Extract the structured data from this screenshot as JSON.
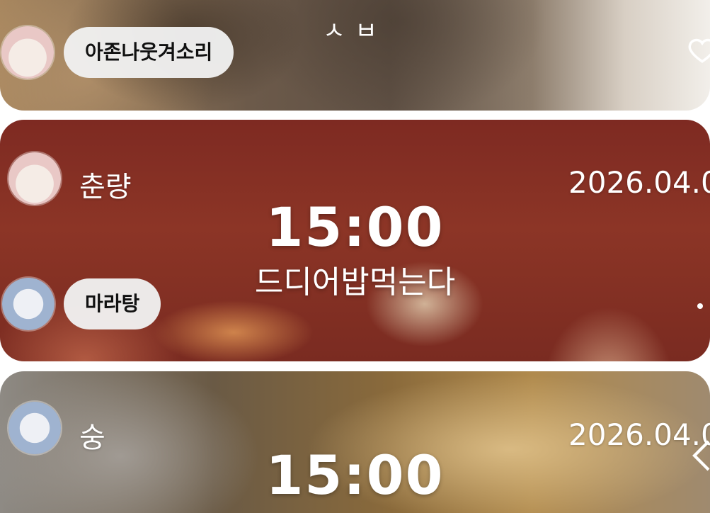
{
  "feed": {
    "top_title": "ㅅㅂ",
    "posts": [
      {
        "reply_user": "아존나웃겨소리"
      },
      {
        "author": "춘량",
        "date": "2026.04.0",
        "time": "15:00",
        "caption": "드디어밥먹는다",
        "reply_user": "마라탕"
      },
      {
        "author": "숭",
        "date": "2026.04.0",
        "time": "15:00"
      }
    ]
  },
  "icons": {
    "like": "heart-icon",
    "more": "dot-icon",
    "nav": "chevron-icon"
  },
  "colors": {
    "pill_bg": "#f0f0f0",
    "text_on_photo": "#ffffff"
  }
}
